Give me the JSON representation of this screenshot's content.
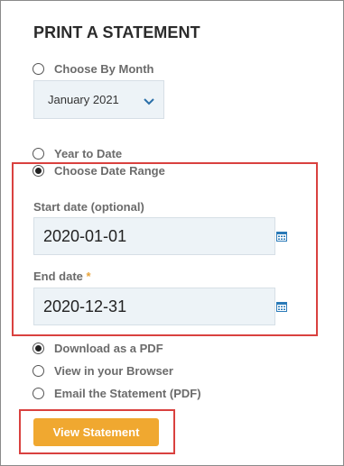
{
  "title": "PRINT A STATEMENT",
  "period_options": [
    {
      "label": "Choose By Month",
      "checked": false
    },
    {
      "label": "Year to Date",
      "checked": false
    },
    {
      "label": "Choose Date Range",
      "checked": true
    }
  ],
  "month_select": {
    "value": "January 2021"
  },
  "start_date": {
    "label": "Start date (optional)",
    "value": "2020-01-01"
  },
  "end_date": {
    "label": "End date",
    "required_marker": "*",
    "value": "2020-12-31"
  },
  "output_options": [
    {
      "label": "Download as a PDF",
      "checked": true
    },
    {
      "label": "View in your Browser",
      "checked": false
    },
    {
      "label": "Email the Statement (PDF)",
      "checked": false
    }
  ],
  "submit_button": {
    "label": "View Statement"
  },
  "colors": {
    "highlight": "#d9413f",
    "button": "#f0a830",
    "input_bg": "#edf3f7",
    "calendar_icon": "#2a7ab8"
  }
}
